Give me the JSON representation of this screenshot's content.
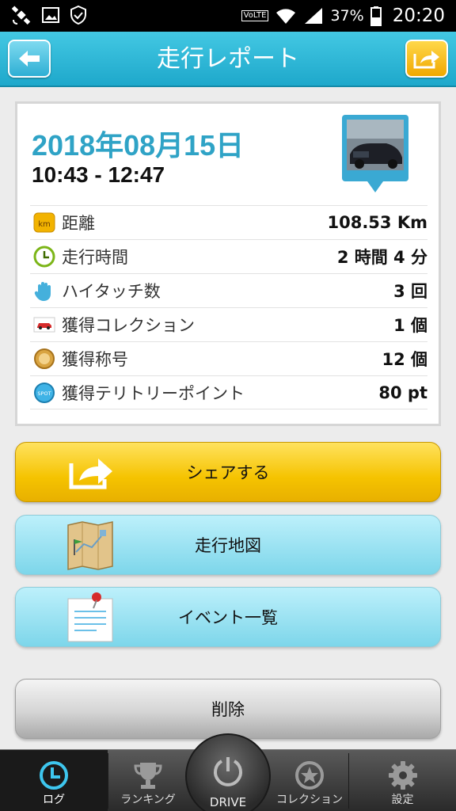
{
  "status_bar": {
    "network_badge": "VoLTE",
    "battery": "37%",
    "time": "20:20",
    "icons": [
      "satellite-icon",
      "image-icon",
      "shield-check-icon",
      "wifi-icon",
      "signal-icon",
      "battery-icon"
    ]
  },
  "header": {
    "title": "走行レポート",
    "back_icon": "arrow-left-icon",
    "share_icon": "share-arrow-icon"
  },
  "report": {
    "date": "2018年08月15日",
    "time_range": "10:43 - 12:47",
    "stats": [
      {
        "icon": "km-icon",
        "label": "距離",
        "value": "108.53 Km"
      },
      {
        "icon": "clock-icon",
        "label": "走行時間",
        "value": "2 時間 4 分"
      },
      {
        "icon": "hand-icon",
        "label": "ハイタッチ数",
        "value": "3 回"
      },
      {
        "icon": "car-icon",
        "label": "獲得コレクション",
        "value": "1 個"
      },
      {
        "icon": "medal-icon",
        "label": "獲得称号",
        "value": "12 個"
      },
      {
        "icon": "spot-icon",
        "label": "獲得テリトリーポイント",
        "value": "80 pt"
      }
    ],
    "spot_badge": "SPOT",
    "km_badge": "km"
  },
  "actions": {
    "share": "シェアする",
    "map": "走行地図",
    "events": "イベント一覧",
    "delete": "削除"
  },
  "tabs": {
    "log": "ログ",
    "ranking": "ランキング",
    "drive": "DRIVE",
    "collection": "コレクション",
    "settings": "設定"
  },
  "colors": {
    "header": "#2bb6d8",
    "date": "#2fa3c6",
    "share_button": "#f5c300",
    "map_button": "#8fdcee",
    "delete_button": "#cccccc"
  }
}
